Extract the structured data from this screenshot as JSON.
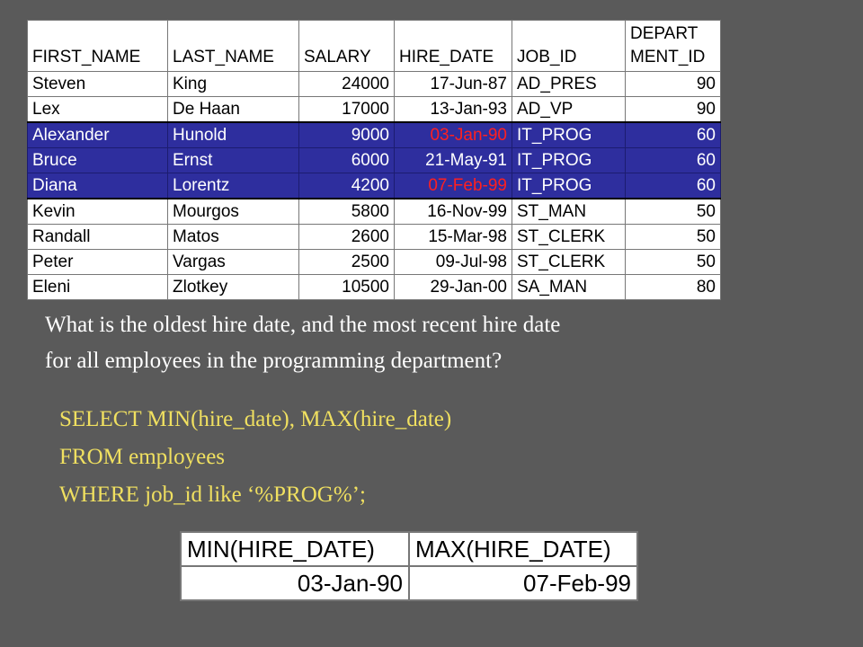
{
  "employees": {
    "headers": [
      "FIRST_NAME",
      "LAST_NAME",
      "SALARY",
      "HIRE_DATE",
      "JOB_ID",
      "DEPART",
      "MENT_ID"
    ],
    "rows": [
      {
        "first": "Steven",
        "last": "King",
        "salary": "24000",
        "hire": "17-Jun-87",
        "job": "AD_PRES",
        "dept": "90"
      },
      {
        "first": "Lex",
        "last": "De Haan",
        "salary": "17000",
        "hire": "13-Jan-93",
        "job": "AD_VP",
        "dept": "90"
      },
      {
        "first": "Alexander",
        "last": "Hunold",
        "salary": "9000",
        "hire": "03-Jan-90",
        "job": "IT_PROG",
        "dept": "60"
      },
      {
        "first": "Bruce",
        "last": "Ernst",
        "salary": "6000",
        "hire": "21-May-91",
        "job": "IT_PROG",
        "dept": "60"
      },
      {
        "first": "Diana",
        "last": "Lorentz",
        "salary": "4200",
        "hire": "07-Feb-99",
        "job": "IT_PROG",
        "dept": "60"
      },
      {
        "first": "Kevin",
        "last": "Mourgos",
        "salary": "5800",
        "hire": "16-Nov-99",
        "job": "ST_MAN",
        "dept": "50"
      },
      {
        "first": "Randall",
        "last": "Matos",
        "salary": "2600",
        "hire": "15-Mar-98",
        "job": "ST_CLERK",
        "dept": "50"
      },
      {
        "first": "Peter",
        "last": "Vargas",
        "salary": "2500",
        "hire": "09-Jul-98",
        "job": "ST_CLERK",
        "dept": "50"
      },
      {
        "first": "Eleni",
        "last": "Zlotkey",
        "salary": "10500",
        "hire": "29-Jan-00",
        "job": "SA_MAN",
        "dept": "80"
      }
    ]
  },
  "question": {
    "line1": "What is the oldest hire date, and the most recent hire date",
    "line2": "for all employees in the programming department?"
  },
  "sql": {
    "line1": "SELECT MIN(hire_date), MAX(hire_date)",
    "line2": "FROM employees",
    "line3": "WHERE job_id like ‘%PROG%’;"
  },
  "result": {
    "headers": [
      "MIN(HIRE_DATE)",
      "MAX(HIRE_DATE)"
    ],
    "values": [
      "03-Jan-90",
      "07-Feb-99"
    ]
  },
  "colors": {
    "background": "#5a5a5a",
    "highlight_row": "#2e2e9e",
    "highlight_date": "#ff2020",
    "sql_text": "#f0e060"
  }
}
